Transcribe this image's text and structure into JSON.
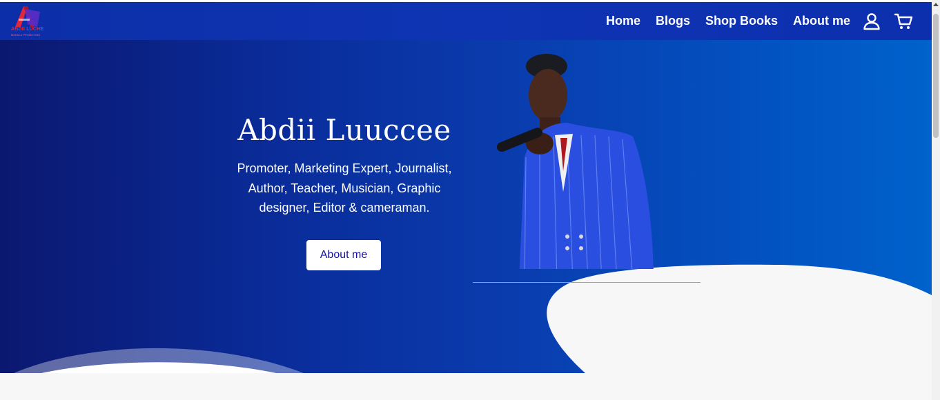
{
  "brand": {
    "logo_text": "ABDII LUCHE",
    "logo_subtext": "MEDIA & PROMOTION"
  },
  "nav": {
    "links": [
      "Home",
      "Blogs",
      "Shop Books",
      "About me"
    ],
    "user_icon": "user-icon",
    "cart_icon": "cart-icon"
  },
  "hero": {
    "title": "Abdii Luuccee",
    "subtitle": "Promoter, Marketing Expert, Journalist, Author, Teacher, Musician, Graphic designer, Editor & cameraman.",
    "button_label": "About me"
  },
  "colors": {
    "navbar": "#0f34b3",
    "hero_start": "#0b1870",
    "hero_end": "#0062cc",
    "button_text": "#1510a8",
    "logo_red": "#e0263a"
  }
}
